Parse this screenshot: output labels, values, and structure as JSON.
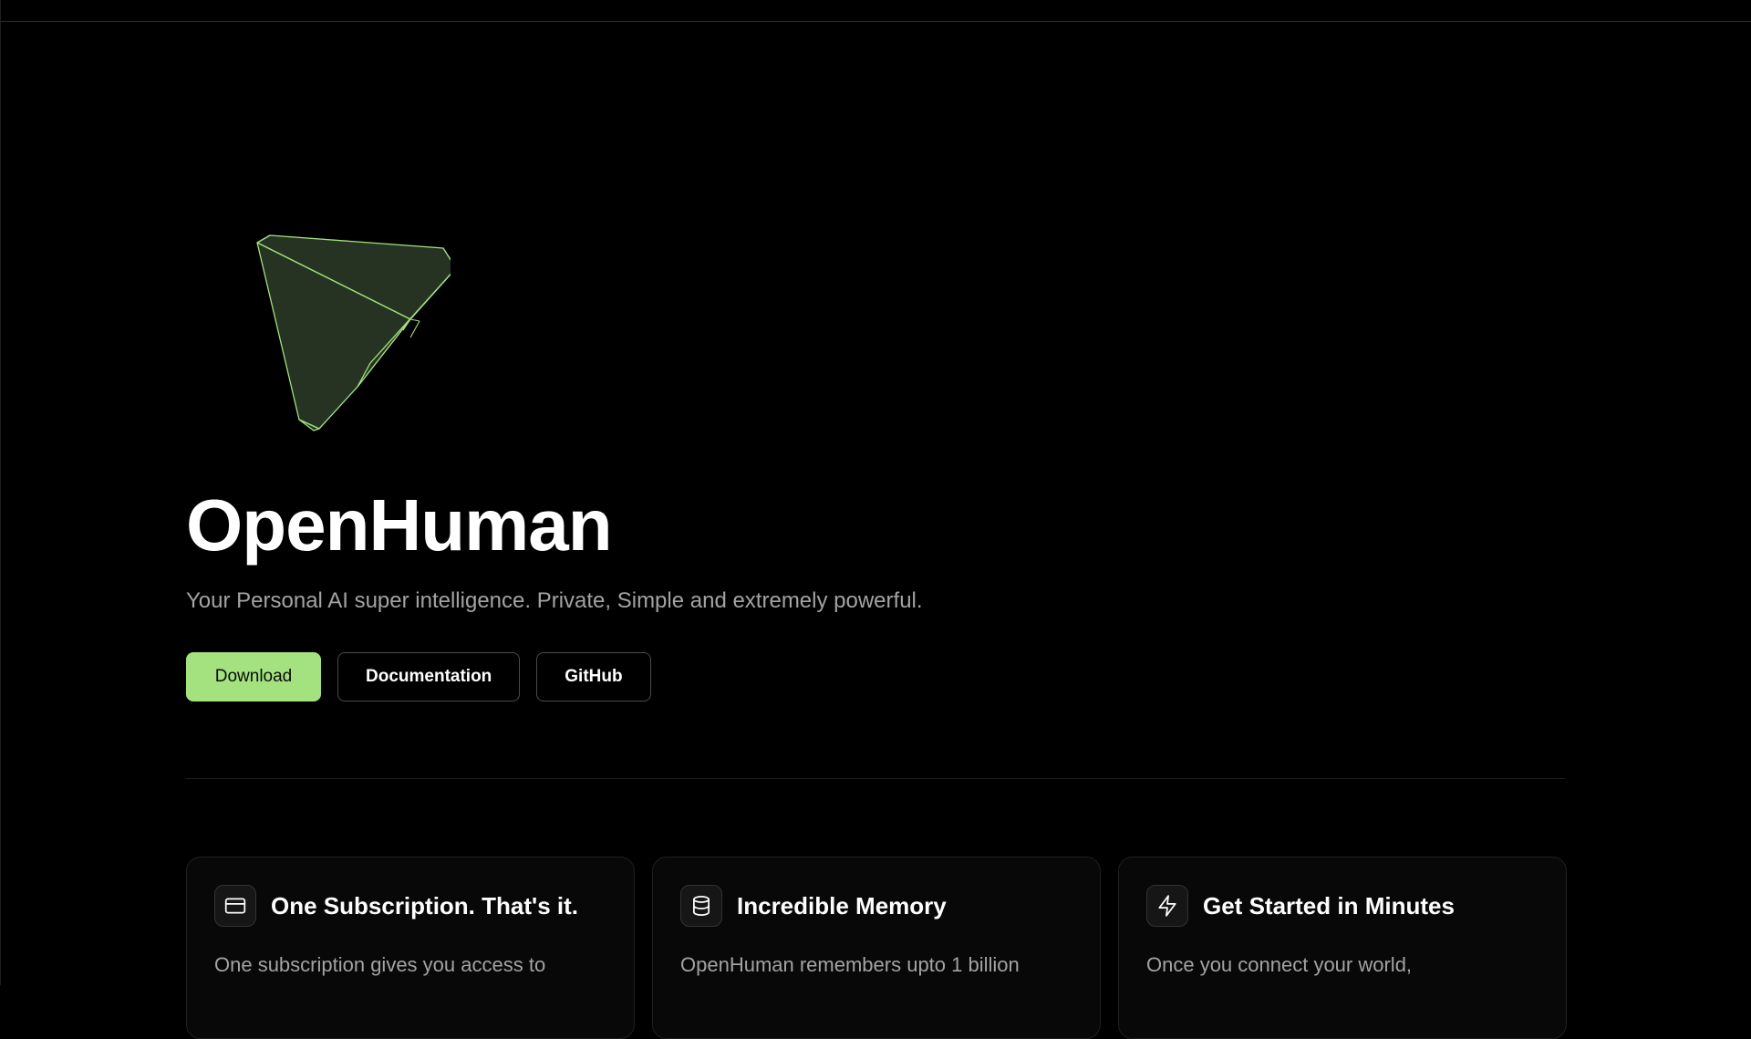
{
  "hero": {
    "title": "OpenHuman",
    "subtitle": "Your Personal AI super intelligence. Private, Simple and extremely powerful.",
    "buttons": {
      "download": "Download",
      "documentation": "Documentation",
      "github": "GitHub"
    },
    "logo_icon": "wireframe-pyramid-logo",
    "accent_color": "#a3e27f"
  },
  "features": [
    {
      "icon": "credit-card-icon",
      "title": "One Subscription. That's it.",
      "text": "One subscription gives you access to"
    },
    {
      "icon": "database-icon",
      "title": "Incredible Memory",
      "text": "OpenHuman remembers upto 1 billion"
    },
    {
      "icon": "lightning-icon",
      "title": "Get Started in Minutes",
      "text": "Once you connect your world,"
    }
  ]
}
